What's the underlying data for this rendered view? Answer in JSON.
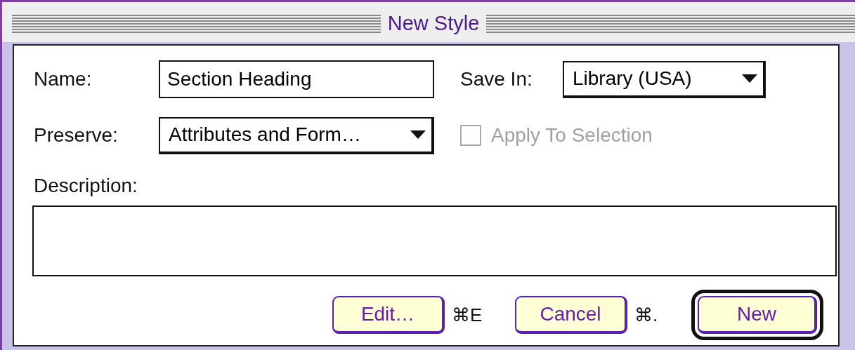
{
  "window": {
    "title": "New Style"
  },
  "name": {
    "label": "Name:",
    "value": "Section Heading"
  },
  "save_in": {
    "label": "Save In:",
    "value": "Library (USA)"
  },
  "preserve": {
    "label": "Preserve:",
    "value": "Attributes and Form…"
  },
  "apply_to_selection": {
    "label": "Apply To Selection",
    "checked": false,
    "disabled": true
  },
  "description": {
    "label": "Description:"
  },
  "buttons": [
    {
      "label": "Edit…",
      "shortcut": "⌘E",
      "default": false
    },
    {
      "label": "Cancel",
      "shortcut": "⌘.",
      "default": false
    },
    {
      "label": "New",
      "default": true
    }
  ]
}
